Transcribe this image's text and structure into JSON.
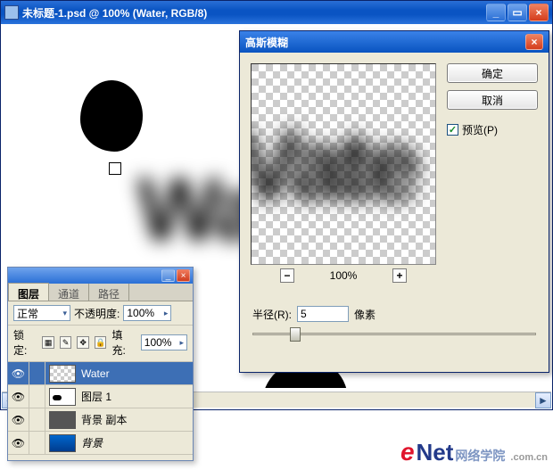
{
  "main_window": {
    "title": "未标题-1.psd @ 100% (Water, RGB/8)",
    "canvas_text": "Wa"
  },
  "dialog": {
    "title": "高斯模糊",
    "ok": "确定",
    "cancel": "取消",
    "preview_checkbox": "预览(P)",
    "preview_text": "Vate",
    "zoom_pct": "100%",
    "radius_label": "半径(R):",
    "radius_value": "5",
    "radius_unit": "像素"
  },
  "layers_panel": {
    "tabs": [
      "图层",
      "通道",
      "路径"
    ],
    "blend_label": "正常",
    "opacity_label": "不透明度:",
    "opacity_value": "100%",
    "lock_label": "锁定:",
    "fill_label": "填充:",
    "fill_value": "100%",
    "layers": [
      {
        "name": "Water",
        "thumb": "checker",
        "selected": true,
        "italic": false
      },
      {
        "name": "图层 1",
        "thumb": "bw",
        "selected": false,
        "italic": false
      },
      {
        "name": "背景 副本",
        "thumb": "noise",
        "selected": false,
        "italic": false
      },
      {
        "name": "背景",
        "thumb": "blue",
        "selected": false,
        "italic": true
      }
    ]
  },
  "watermark": {
    "e": "e",
    "net": "Net",
    "sub": "网络学院",
    "cn": ".com.cn"
  }
}
